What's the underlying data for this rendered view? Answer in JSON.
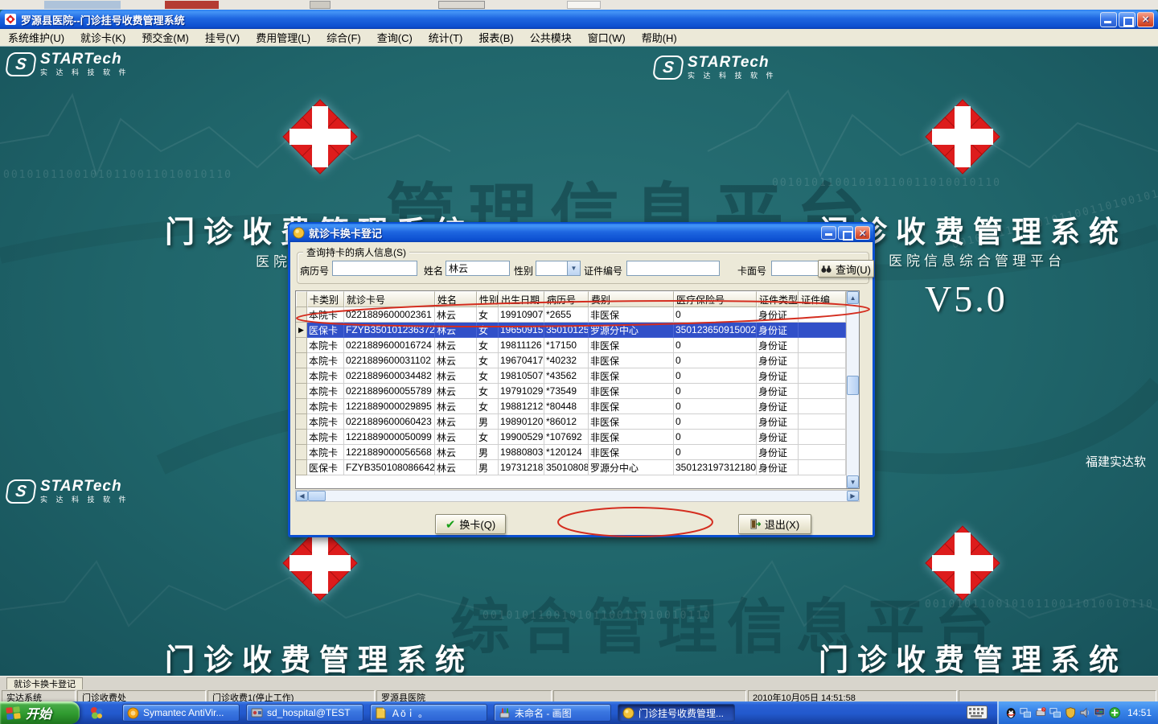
{
  "window": {
    "title": "罗源县医院--门诊挂号收费管理系统"
  },
  "menu": {
    "items": [
      "系统维护(U)",
      "就诊卡(K)",
      "预交金(M)",
      "挂号(V)",
      "费用管理(L)",
      "综合(F)",
      "查询(C)",
      "统计(T)",
      "报表(B)",
      "公共模块",
      "窗口(W)",
      "帮助(H)"
    ]
  },
  "background": {
    "brand": "STARTech",
    "brand_sub": "实 达 科 技 软 件",
    "slogan": "门诊收费管理系统",
    "platform": "医院信息综合管理平台",
    "version": "V5.0",
    "vendor": "福建实达软",
    "binary": "00101011001010110011010010110",
    "watermark_top": "管理信息平台",
    "watermark_bottom": "综合管理信息平台",
    "teal": "#20666b",
    "cross_red": "#dd1c1c"
  },
  "dialog": {
    "title": "就诊卡换卡登记",
    "group_label": "查询持卡的病人信息(S)",
    "annotation_color": "#d42d1f",
    "search": {
      "record_no_label": "病历号",
      "record_no_value": "",
      "name_label": "姓名",
      "name_value": "林云",
      "gender_label": "性别",
      "gender_value": "",
      "cert_no_label": "证件编号",
      "cert_no_value": "",
      "card_face_label": "卡面号",
      "card_face_value": "",
      "query_button": "查询(U)"
    },
    "table": {
      "headers": [
        "卡类别",
        "就诊卡号",
        "姓名",
        "性别",
        "出生日期",
        "病历号",
        "费别",
        "医疗保险号",
        "证件类型",
        "证件编"
      ],
      "selected_index": 1,
      "rows": [
        [
          "本院卡",
          "0221889600002361",
          "林云",
          "女",
          "19910907",
          "*2655",
          "非医保",
          "0",
          "身份证",
          ""
        ],
        [
          "医保卡",
          "FZYB350101236372",
          "林云",
          "女",
          "19650915",
          "35010125",
          "罗源分中心",
          "350123650915002",
          "身份证",
          ""
        ],
        [
          "本院卡",
          "0221889600016724",
          "林云",
          "女",
          "19811126",
          "*17150",
          "非医保",
          "0",
          "身份证",
          ""
        ],
        [
          "本院卡",
          "0221889600031102",
          "林云",
          "女",
          "19670417",
          "*40232",
          "非医保",
          "0",
          "身份证",
          ""
        ],
        [
          "本院卡",
          "0221889600034482",
          "林云",
          "女",
          "19810507",
          "*43562",
          "非医保",
          "0",
          "身份证",
          ""
        ],
        [
          "本院卡",
          "0221889600055789",
          "林云",
          "女",
          "19791029",
          "*73549",
          "非医保",
          "0",
          "身份证",
          ""
        ],
        [
          "本院卡",
          "1221889000029895",
          "林云",
          "女",
          "19881212",
          "*80448",
          "非医保",
          "0",
          "身份证",
          ""
        ],
        [
          "本院卡",
          "0221889600060423",
          "林云",
          "男",
          "19890120",
          "*86012",
          "非医保",
          "0",
          "身份证",
          ""
        ],
        [
          "本院卡",
          "1221889000050099",
          "林云",
          "女",
          "19900529",
          "*107692",
          "非医保",
          "0",
          "身份证",
          ""
        ],
        [
          "本院卡",
          "1221889000056568",
          "林云",
          "男",
          "19880803",
          "*120124",
          "非医保",
          "0",
          "身份证",
          ""
        ],
        [
          "医保卡",
          "FZYB350108086642",
          "林云",
          "男",
          "19731218",
          "35010808",
          "罗源分中心",
          "350123197312180",
          "身份证",
          ""
        ]
      ]
    },
    "buttons": {
      "change_card": "换卡(Q)",
      "exit": "退出(X)"
    }
  },
  "mdi": {
    "tab": "就诊卡换卡登记"
  },
  "statusbar": {
    "segments": [
      "实达系统",
      "门诊收费处",
      "门诊收费1(停止工作)",
      "罗源县医院",
      "",
      "2010年10月05日  14:51:58"
    ]
  },
  "taskbar": {
    "start": "开始",
    "tasks": [
      "Symantec AntiVir...",
      "sd_hospital@TEST",
      "Ａǒｉ 。",
      "未命名 - 画图",
      "门诊挂号收费管理..."
    ],
    "active_task_index": 4,
    "clock": "14:51"
  }
}
